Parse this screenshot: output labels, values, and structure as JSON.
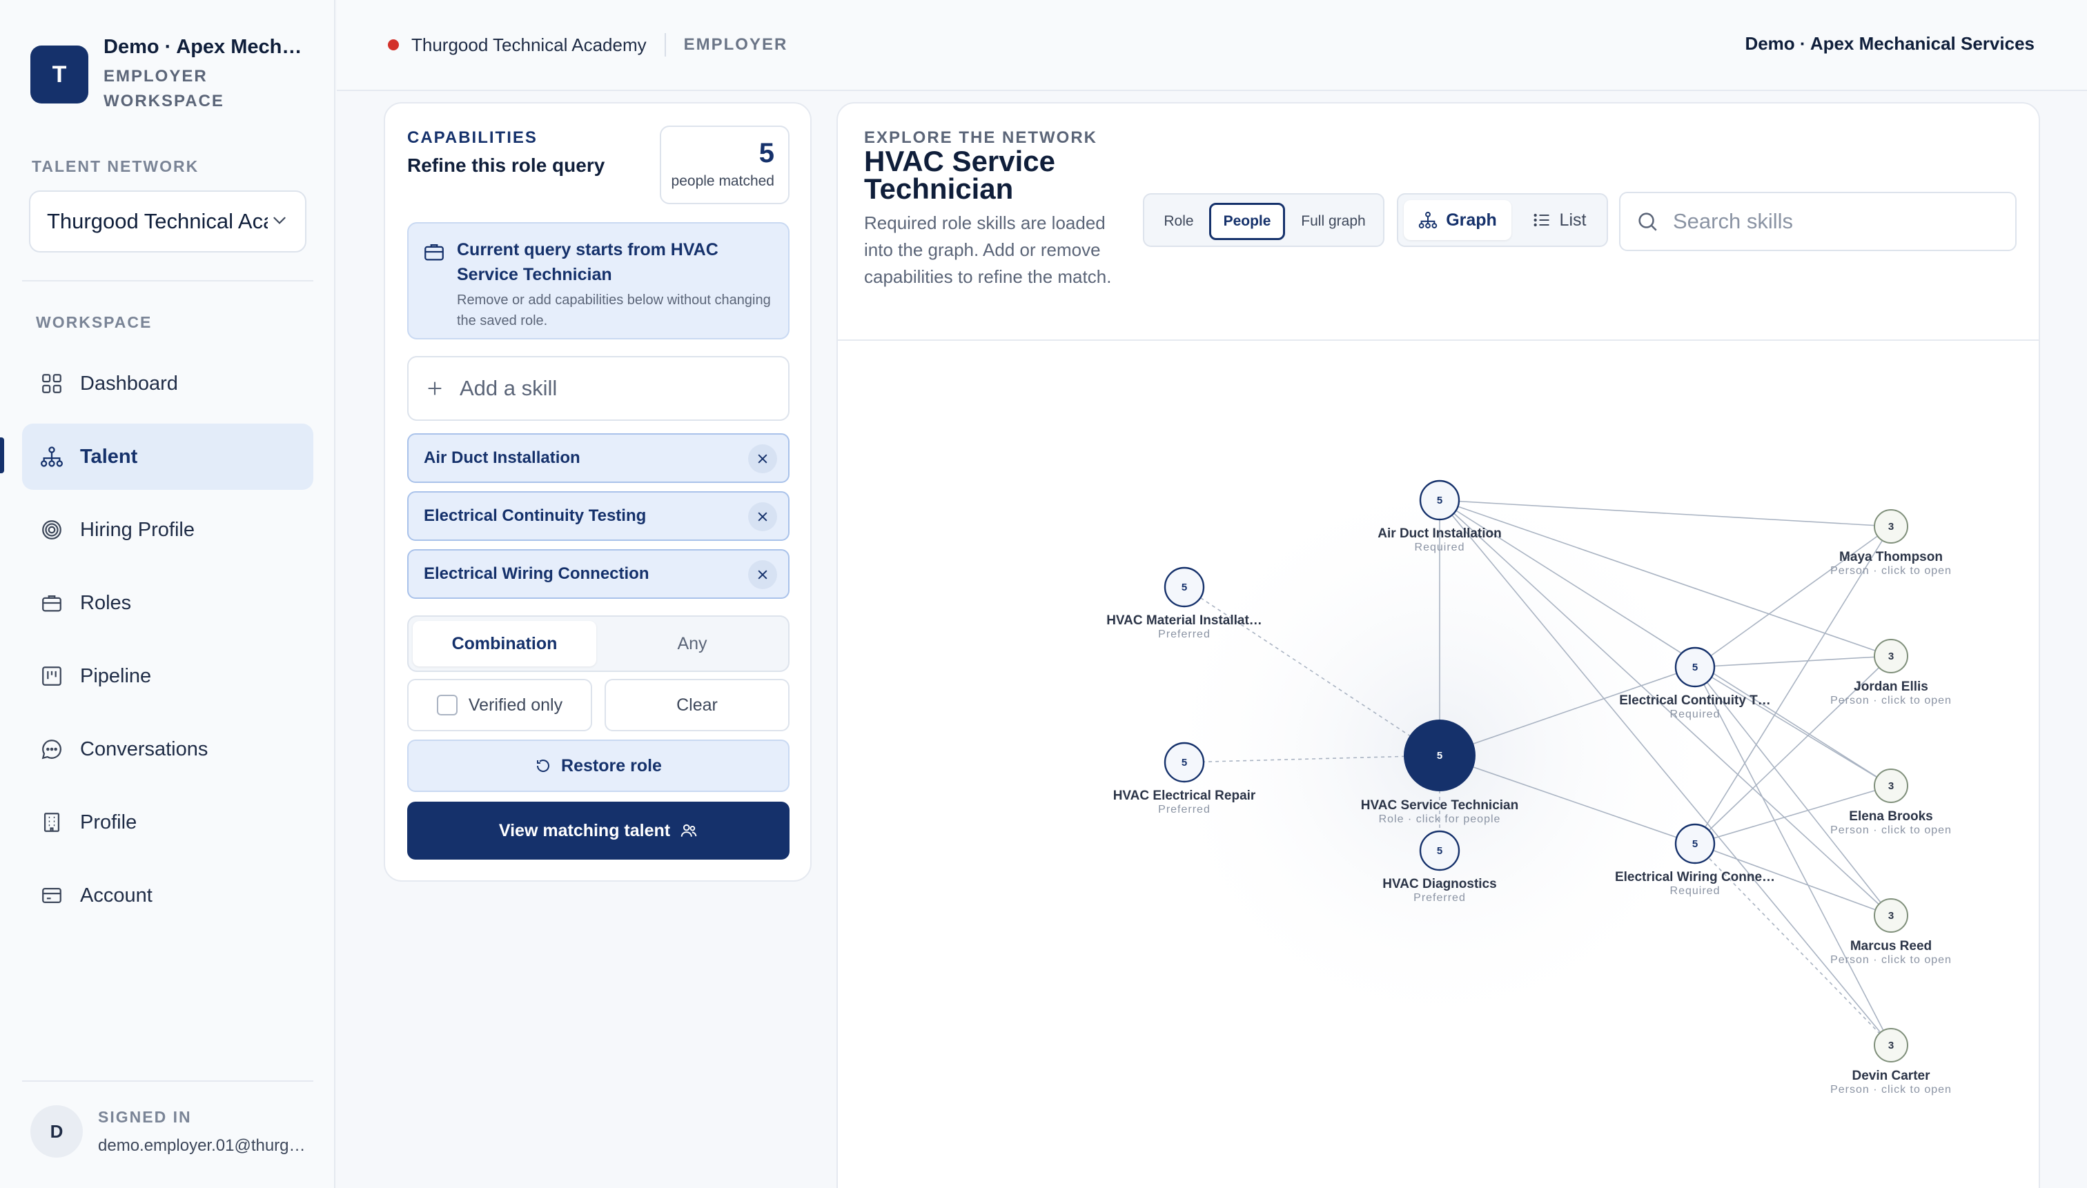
{
  "sidebar": {
    "workspace_initial": "T",
    "workspace_name": "Demo · Apex Mech…",
    "workspace_sub": "EMPLOYER WORKSPACE",
    "network_label": "TALENT NETWORK",
    "network_value": "Thurgood Technical Academy",
    "workspace_label": "WORKSPACE",
    "nav": [
      {
        "label": "Dashboard",
        "icon": "grid-icon"
      },
      {
        "label": "Talent",
        "icon": "org-chart-icon",
        "active": true
      },
      {
        "label": "Hiring Profile",
        "icon": "target-icon"
      },
      {
        "label": "Roles",
        "icon": "briefcase-icon"
      },
      {
        "label": "Pipeline",
        "icon": "kanban-icon"
      },
      {
        "label": "Conversations",
        "icon": "chat-icon"
      },
      {
        "label": "Profile",
        "icon": "building-icon"
      },
      {
        "label": "Account",
        "icon": "credit-card-icon"
      }
    ],
    "signed_in_label": "SIGNED IN",
    "avatar_initial": "D",
    "user_email": "demo.employer.01@thurg…"
  },
  "topbar": {
    "org": "Thurgood Technical Academy",
    "role": "EMPLOYER",
    "company": "Demo · Apex Mechanical Services",
    "status_color": "#d3312a"
  },
  "capabilities": {
    "title": "CAPABILITIES",
    "subtitle": "Refine this role query",
    "matched_count": "5",
    "matched_label": "people matched",
    "query_heading": "Current query starts from HVAC Service Technician",
    "query_note": "Remove or add capabilities below without changing the saved role.",
    "add_placeholder": "Add a skill",
    "chips": [
      "Air Duct Installation",
      "Electrical Continuity Testing",
      "Electrical Wiring Connection"
    ],
    "mode_combination": "Combination",
    "mode_any": "Any",
    "verified_label": "Verified only",
    "clear_label": "Clear",
    "restore_label": "Restore role",
    "view_label": "View matching talent"
  },
  "explore": {
    "kicker": "EXPLORE THE NETWORK",
    "title": "HVAC Service Technician",
    "description": "Required role skills are loaded into the graph. Add or remove capabilities to refine the match.",
    "view_options": [
      "Role",
      "People",
      "Full graph"
    ],
    "view_selected": "People",
    "mode_graph": "Graph",
    "mode_list": "List",
    "search_placeholder": "Search skills"
  },
  "graph": {
    "nodes": [
      {
        "id": "role",
        "label": "HVAC Service Technician",
        "sub": "Role · click for people",
        "count": "5",
        "kind": "role"
      },
      {
        "id": "air",
        "label": "Air Duct Installation",
        "sub": "Required",
        "count": "5",
        "kind": "skill"
      },
      {
        "id": "mat",
        "label": "HVAC Material Installat…",
        "sub": "Preferred",
        "count": "5",
        "kind": "skill"
      },
      {
        "id": "rep",
        "label": "HVAC Electrical Repair",
        "sub": "Preferred",
        "count": "5",
        "kind": "skill"
      },
      {
        "id": "diag",
        "label": "HVAC Diagnostics",
        "sub": "Preferred",
        "count": "5",
        "kind": "skill"
      },
      {
        "id": "cont",
        "label": "Electrical Continuity T…",
        "sub": "Required",
        "count": "5",
        "kind": "skill"
      },
      {
        "id": "wire",
        "label": "Electrical Wiring Conne…",
        "sub": "Required",
        "count": "5",
        "kind": "skill"
      },
      {
        "id": "maya",
        "label": "Maya Thompson",
        "sub": "Person · click to open",
        "count": "3",
        "kind": "person"
      },
      {
        "id": "jordan",
        "label": "Jordan Ellis",
        "sub": "Person · click to open",
        "count": "3",
        "kind": "person"
      },
      {
        "id": "elena",
        "label": "Elena Brooks",
        "sub": "Person · click to open",
        "count": "3",
        "kind": "person"
      },
      {
        "id": "marcus",
        "label": "Marcus Reed",
        "sub": "Person · click to open",
        "count": "3",
        "kind": "person"
      },
      {
        "id": "devin",
        "label": "Devin Carter",
        "sub": "Person · click to open",
        "count": "3",
        "kind": "person"
      }
    ]
  }
}
